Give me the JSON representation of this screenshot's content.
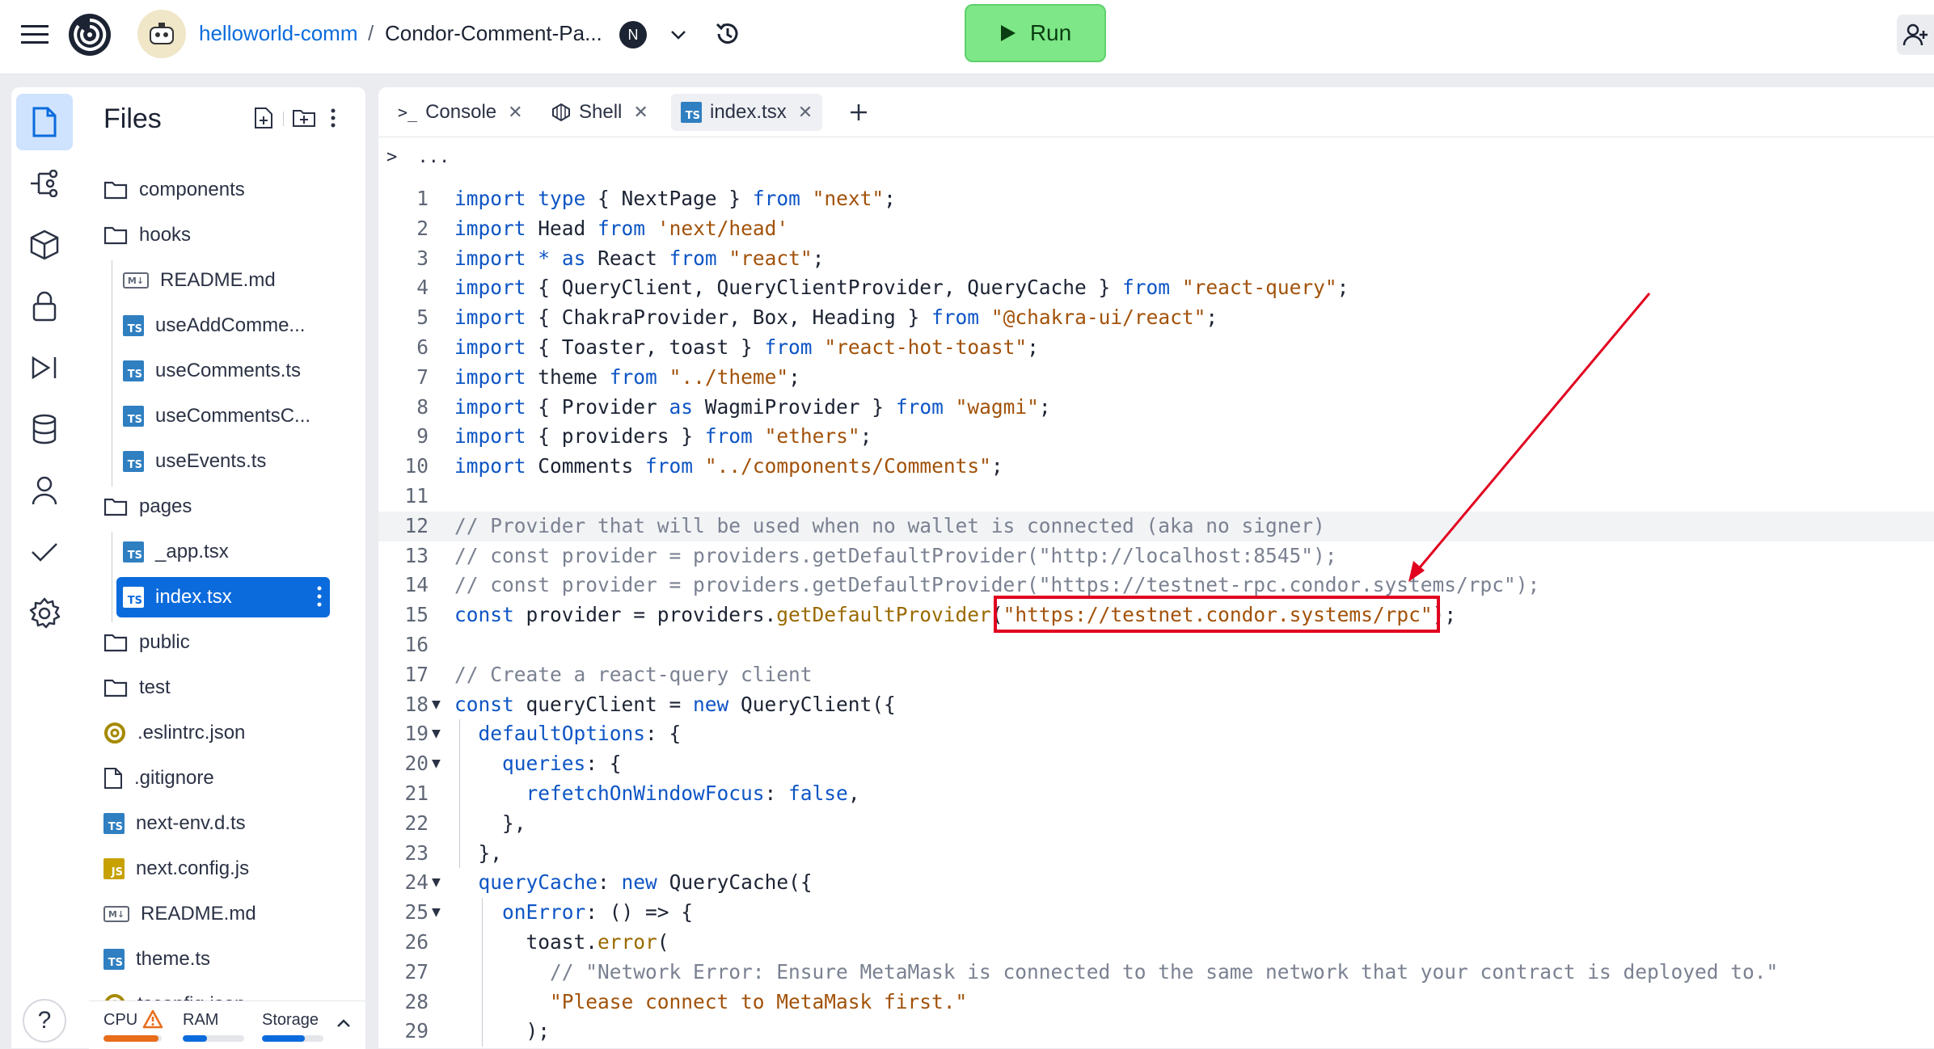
{
  "header": {
    "owner": "helloworld-comm",
    "separator": "/",
    "repl_name": "Condor-Comment-Pa...",
    "nix_badge": "N",
    "run_label": "Run"
  },
  "sidebar": {
    "title": "Files",
    "rail_icons": [
      "file-icon",
      "git-branch-icon",
      "package-icon",
      "lock-icon",
      "debugger-icon",
      "database-icon",
      "user-icon",
      "check-icon",
      "settings-icon"
    ],
    "tree": [
      {
        "name": "components",
        "type": "folder",
        "indent": 0
      },
      {
        "name": "hooks",
        "type": "folder",
        "indent": 0
      },
      {
        "name": "README.md",
        "type": "md",
        "indent": 1
      },
      {
        "name": "useAddComme...",
        "type": "ts",
        "indent": 1
      },
      {
        "name": "useComments.ts",
        "type": "ts",
        "indent": 1
      },
      {
        "name": "useCommentsC...",
        "type": "ts",
        "indent": 1
      },
      {
        "name": "useEvents.ts",
        "type": "ts",
        "indent": 1
      },
      {
        "name": "pages",
        "type": "folder",
        "indent": 0
      },
      {
        "name": "_app.tsx",
        "type": "ts",
        "indent": 1
      },
      {
        "name": "index.tsx",
        "type": "ts",
        "indent": 1,
        "selected": true
      },
      {
        "name": "public",
        "type": "folder",
        "indent": 0
      },
      {
        "name": "test",
        "type": "folder",
        "indent": 0
      },
      {
        "name": ".eslintrc.json",
        "type": "eslint",
        "indent": 0
      },
      {
        "name": ".gitignore",
        "type": "file",
        "indent": 0
      },
      {
        "name": "next-env.d.ts",
        "type": "ts",
        "indent": 0
      },
      {
        "name": "next.config.js",
        "type": "js",
        "indent": 0
      },
      {
        "name": "README.md",
        "type": "md",
        "indent": 0
      },
      {
        "name": "theme.ts",
        "type": "ts",
        "indent": 0
      },
      {
        "name": "tsconfig.json",
        "type": "eslint",
        "indent": 0
      }
    ],
    "resources": {
      "cpu_label": "CPU",
      "ram_label": "RAM",
      "storage_label": "Storage",
      "cpu_usage": 0.95,
      "ram_usage": 0.4,
      "storage_usage": 0.7,
      "cpu_color": "#e86c1a",
      "ram_color": "#0b6bdc",
      "storage_color": "#0b6bdc"
    },
    "help_label": "?"
  },
  "editor": {
    "tabs": [
      {
        "label": "Console",
        "icon": "console-icon"
      },
      {
        "label": "Shell",
        "icon": "shell-icon"
      },
      {
        "label": "index.tsx",
        "icon": "ts-icon",
        "active": true
      }
    ],
    "breadcrumb": "...",
    "code_lines": [
      {
        "n": "1",
        "t": "import type { NextPage } from \"next\";"
      },
      {
        "n": "2",
        "t": "import Head from 'next/head'"
      },
      {
        "n": "3",
        "t": "import * as React from \"react\";"
      },
      {
        "n": "4",
        "t": "import { QueryClient, QueryClientProvider, QueryCache } from \"react-query\";"
      },
      {
        "n": "5",
        "t": "import { ChakraProvider, Box, Heading } from \"@chakra-ui/react\";"
      },
      {
        "n": "6",
        "t": "import { Toaster, toast } from \"react-hot-toast\";"
      },
      {
        "n": "7",
        "t": "import theme from \"../theme\";"
      },
      {
        "n": "8",
        "t": "import { Provider as WagmiProvider } from \"wagmi\";"
      },
      {
        "n": "9",
        "t": "import { providers } from \"ethers\";"
      },
      {
        "n": "10",
        "t": "import Comments from \"../components/Comments\";"
      },
      {
        "n": "11",
        "t": ""
      },
      {
        "n": "12",
        "t": "// Provider that will be used when no wallet is connected (aka no signer)"
      },
      {
        "n": "13",
        "t": "// const provider = providers.getDefaultProvider(\"http://localhost:8545\");"
      },
      {
        "n": "14",
        "t": "// const provider = providers.getDefaultProvider(\"https://testnet-rpc.condor.systems/rpc\");"
      },
      {
        "n": "15",
        "t": "const provider = providers.getDefaultProvider(\"https://testnet.condor.systems/rpc\");"
      },
      {
        "n": "16",
        "t": ""
      },
      {
        "n": "17",
        "t": "// Create a react-query client"
      },
      {
        "n": "18",
        "t": "const queryClient = new QueryClient({"
      },
      {
        "n": "19",
        "t": "  defaultOptions: {"
      },
      {
        "n": "20",
        "t": "    queries: {"
      },
      {
        "n": "21",
        "t": "      refetchOnWindowFocus: false,"
      },
      {
        "n": "22",
        "t": "    },"
      },
      {
        "n": "23",
        "t": "  },"
      },
      {
        "n": "24",
        "t": "  queryCache: new QueryCache({"
      },
      {
        "n": "25",
        "t": "    onError: () => {"
      },
      {
        "n": "26",
        "t": "      toast.error("
      },
      {
        "n": "27",
        "t": "        // \"Network Error: Ensure MetaMask is connected to the same network that your contract is deployed to.\""
      },
      {
        "n": "28",
        "t": "        \"Please connect to MetaMask first.\""
      },
      {
        "n": "29",
        "t": "      );"
      }
    ]
  },
  "colors": {
    "accent": "#0b6bdc",
    "run_button": "#7ee787",
    "annotation": "#e1001f"
  }
}
